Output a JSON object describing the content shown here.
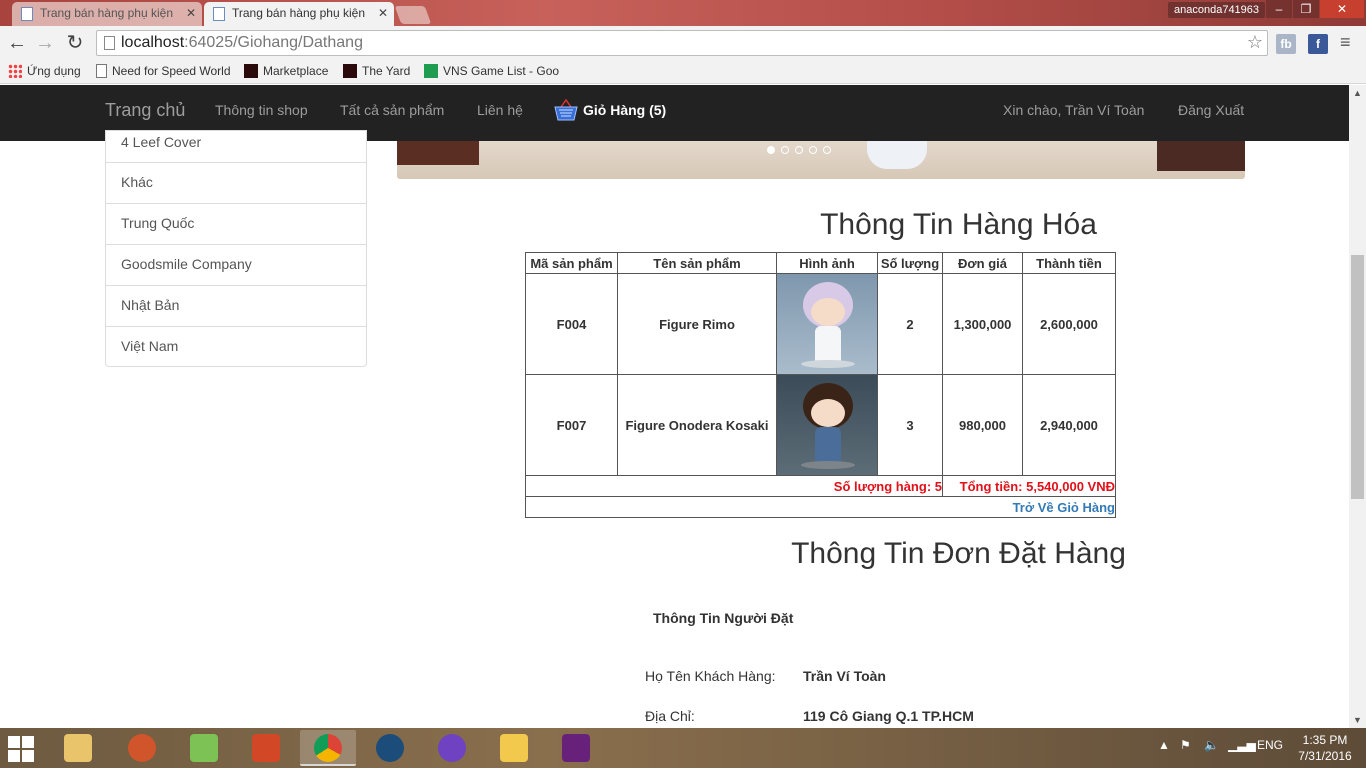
{
  "browser": {
    "tabs": [
      {
        "title": "Trang bán hàng phụ kiện",
        "active": false
      },
      {
        "title": "Trang bán hàng phụ kiện",
        "active": true
      }
    ],
    "profile": "anaconda741963",
    "url_host": "localhost",
    "url_path": ":64025/Giohang/Dathang",
    "bookmarks": [
      {
        "label": "Ứng dụng",
        "icon": "apps-grid-icon"
      },
      {
        "label": "Need for Speed World",
        "icon": "page-icon"
      },
      {
        "label": "Marketplace",
        "icon": "game-icon"
      },
      {
        "label": "The Yard",
        "icon": "game-icon"
      },
      {
        "label": "VNS Game List - Goo",
        "icon": "sheets-icon"
      }
    ],
    "extensions": [
      "fb",
      "f"
    ]
  },
  "site_nav": {
    "brand": "Trang chủ",
    "links": [
      "Thông tin shop",
      "Tất cả sản phẩm",
      "Liên hệ"
    ],
    "cart_label": "Giỏ Hàng (5)",
    "greeting": "Xin chào, Trần Ví Toàn",
    "logout": "Đăng Xuất"
  },
  "sidebar": {
    "items": [
      "4 Leef Cover",
      "Khác",
      "Trung Quốc",
      "Goodsmile Company",
      "Nhật Bản",
      "Việt Nam"
    ]
  },
  "goods": {
    "title": "Thông Tin Hàng Hóa",
    "headers": [
      "Mã sản phẩm",
      "Tên sản phẩm",
      "Hình ảnh",
      "Số lượng",
      "Đơn giá",
      "Thành tiền"
    ],
    "rows": [
      {
        "code": "F004",
        "name": "Figure Rimo",
        "image": "figure-rimo-image",
        "qty": "2",
        "price": "1,300,000",
        "total": "2,600,000"
      },
      {
        "code": "F007",
        "name": "Figure Onodera Kosaki",
        "image": "figure-onodera-image",
        "qty": "3",
        "price": "980,000",
        "total": "2,940,000"
      }
    ],
    "qty_summary": "Số lượng hàng: 5",
    "total_summary": "Tổng tiền: 5,540,000 VNĐ",
    "back_link": "Trở Về Giỏ Hàng"
  },
  "order": {
    "title": "Thông Tin Đơn Đặt Hàng",
    "orderer_heading": "Thông Tin Người Đặt",
    "fields": [
      {
        "label": "Họ Tên Khách Hàng:",
        "value": "Trần Ví Toàn"
      },
      {
        "label": "Địa Chỉ:",
        "value": "119 Cô Giang Q.1 TP.HCM"
      }
    ]
  },
  "taskbar": {
    "apps": [
      "file-explorer-icon",
      "audio-app-icon",
      "android-studio-icon",
      "powerpoint-icon",
      "chrome-icon",
      "tree-app-icon",
      "github-icon",
      "sticky-app-icon",
      "visual-studio-icon"
    ],
    "language": "ENG",
    "time": "1:35 PM",
    "date": "7/31/2016"
  },
  "colors": {
    "navbar_bg": "#222222",
    "summary_red": "#e0111a",
    "link_blue": "#337ab7"
  }
}
